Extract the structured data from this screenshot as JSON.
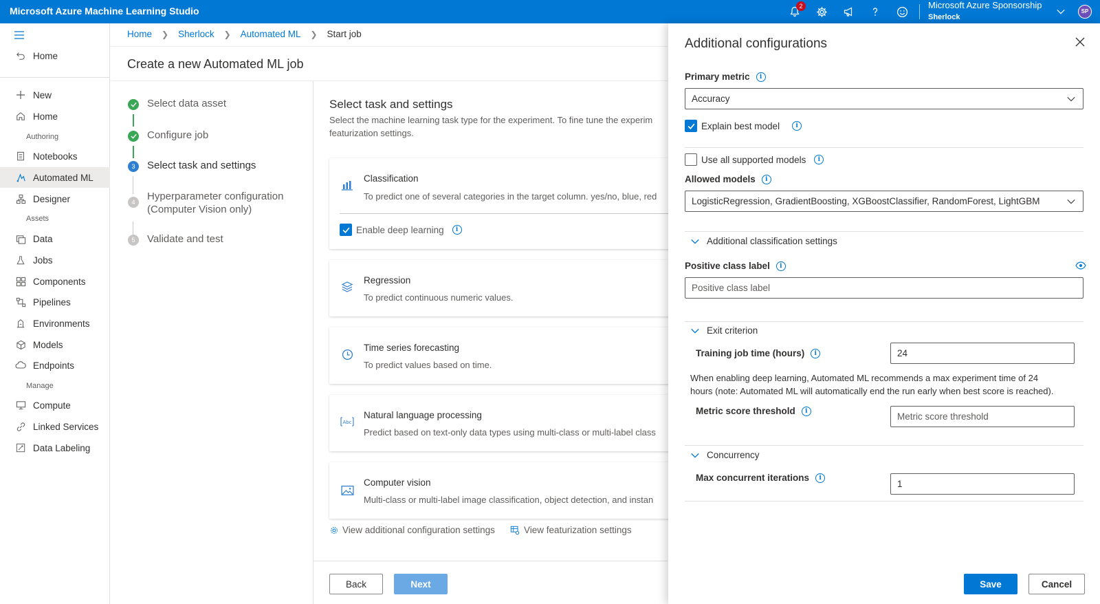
{
  "app": {
    "title": "Microsoft Azure Machine Learning Studio"
  },
  "topbar": {
    "notifications_count": "2",
    "tenant": {
      "line1": "Microsoft Azure Sponsorship",
      "line2": "Sherlock"
    },
    "avatar_initials": "SP",
    "icons": [
      "bell-icon",
      "gear-icon",
      "megaphone-icon",
      "help-icon",
      "smiley-icon",
      "chevron-down-icon"
    ]
  },
  "nav": {
    "home_top": "Home",
    "new": "New",
    "home": "Home",
    "sections": {
      "authoring": "Authoring",
      "assets": "Assets",
      "manage": "Manage"
    },
    "notebooks": "Notebooks",
    "automated_ml": "Automated ML",
    "designer": "Designer",
    "data": "Data",
    "jobs": "Jobs",
    "components": "Components",
    "pipelines": "Pipelines",
    "environments": "Environments",
    "models": "Models",
    "endpoints": "Endpoints",
    "compute": "Compute",
    "linked_services": "Linked Services",
    "data_labeling": "Data Labeling"
  },
  "breadcrumb": [
    "Home",
    "Sherlock",
    "Automated ML",
    "Start job"
  ],
  "page": {
    "title": "Create a new Automated ML job"
  },
  "steps": [
    {
      "label": "Select data asset",
      "state": "done",
      "num": "1"
    },
    {
      "label": "Configure job",
      "state": "done",
      "num": "2"
    },
    {
      "label": "Select task and settings",
      "state": "current",
      "num": "3"
    },
    {
      "label_line1": "Hyperparameter configuration",
      "label_line2": "(Computer Vision only)",
      "state": "todo",
      "num": "4"
    },
    {
      "label": "Validate and test",
      "state": "todo",
      "num": "5"
    }
  ],
  "main": {
    "title": "Select task and settings",
    "desc_line1": "Select the machine learning task type for the experiment. To fine tune the experim",
    "desc_line2": "featurization settings.",
    "tasks": {
      "classification": {
        "title": "Classification",
        "desc": "To predict one of several categories in the target column. yes/no, blue, red",
        "deep_learning": "Enable deep learning"
      },
      "regression": {
        "title": "Regression",
        "desc": "To predict continuous numeric values."
      },
      "timeseries": {
        "title": "Time series forecasting",
        "desc": "To predict values based on time."
      },
      "nlp": {
        "title": "Natural language processing",
        "desc": "Predict based on text-only data types using multi-class or multi-label class"
      },
      "cv": {
        "title": "Computer vision",
        "desc": "Multi-class or multi-label image classification, object detection, and instan"
      }
    },
    "links": {
      "additional": "View additional configuration settings",
      "featurization": "View featurization settings"
    },
    "buttons": {
      "back": "Back",
      "next": "Next"
    }
  },
  "flyout": {
    "title": "Additional configurations",
    "primary_metric": {
      "label": "Primary metric",
      "value": "Accuracy"
    },
    "explain_best_model": {
      "label": "Explain best model",
      "checked": true
    },
    "use_all_models": {
      "label": "Use all supported models",
      "checked": false
    },
    "allowed_models": {
      "label": "Allowed models",
      "value": "LogisticRegression, GradientBoosting, XGBoostClassifier, RandomForest, LightGBM"
    },
    "additional_classification": "Additional classification settings",
    "positive_class": {
      "label": "Positive class label",
      "placeholder": "Positive class label"
    },
    "exit_criterion": "Exit criterion",
    "training_time": {
      "label": "Training job time (hours)",
      "value": "24"
    },
    "note_line1": "When enabling deep learning, Automated ML recommends a max experiment time of 24",
    "note_line2": "hours (note: Automated ML will automatically end the run early when best score is reached).",
    "metric_threshold": {
      "label": "Metric score threshold",
      "placeholder": "Metric score threshold"
    },
    "concurrency": "Concurrency",
    "max_concurrent": {
      "label": "Max concurrent iterations",
      "value": "1"
    },
    "buttons": {
      "save": "Save",
      "cancel": "Cancel"
    }
  },
  "colors": {
    "accent": "#0078d4",
    "success": "#3aa757",
    "badge": "#c50f1f"
  }
}
